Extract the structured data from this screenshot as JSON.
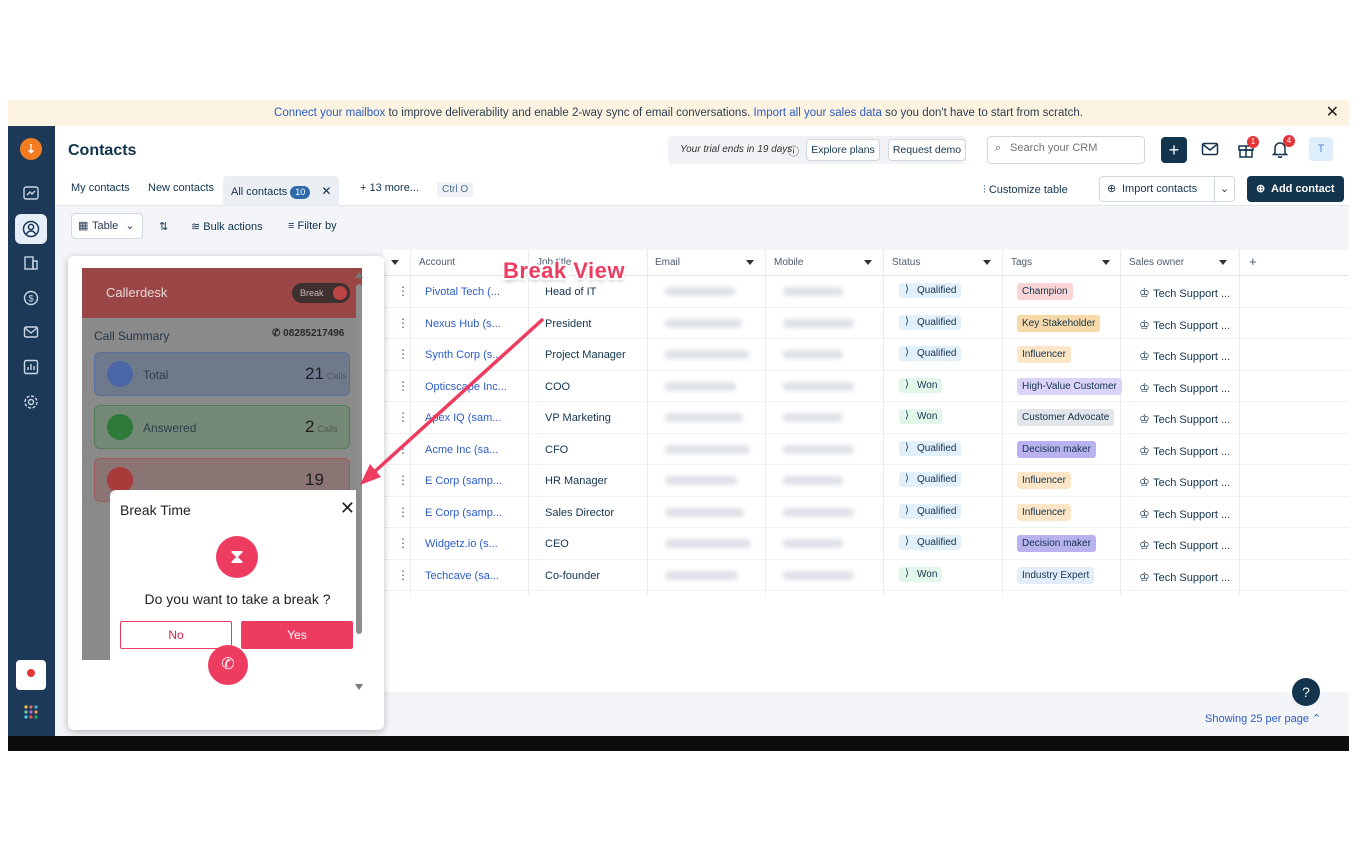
{
  "banner": {
    "link1": "Connect your mailbox",
    "text1": " to improve deliverability and enable 2-way sync of email conversations. ",
    "link2": "Import all your sales data",
    "text2": " so you don't have to start from scratch.",
    "close": "✕"
  },
  "header": {
    "title": "Contacts",
    "trial_text": "Your trial ends in 19 days",
    "explore_plans": "Explore plans",
    "request_demo": "Request demo",
    "search_placeholder": "Search your CRM",
    "plus": "+",
    "gift_badge": "1",
    "bell_badge": "4",
    "avatar": "T"
  },
  "tabs": {
    "my_contacts": "My contacts",
    "new_contacts": "New contacts",
    "all_contacts": "All contacts",
    "all_count": "10",
    "more": "+ 13 more...",
    "shortcut": "Ctrl O",
    "customize": "Customize table",
    "import": "Import contacts",
    "add_contact": "Add contact"
  },
  "toolbar": {
    "table": "Table",
    "bulk_actions": "Bulk actions",
    "filter_by": "Filter by"
  },
  "table": {
    "columns": [
      "Account",
      "Job title",
      "Email",
      "Mobile",
      "Status",
      "Tags",
      "Sales owner"
    ],
    "add_col": "+",
    "rows": [
      {
        "account": "Pivotal Tech (...",
        "job": "Head of IT",
        "status": "Qualified",
        "tag": "Champion",
        "owner": "Tech Support ..."
      },
      {
        "account": "Nexus Hub (s...",
        "job": "President",
        "status": "Qualified",
        "tag": "Key Stakeholder",
        "owner": "Tech Support ..."
      },
      {
        "account": "Synth Corp (s...",
        "job": "Project Manager",
        "status": "Qualified",
        "tag": "Influencer",
        "owner": "Tech Support ..."
      },
      {
        "account": "Opticscape Inc...",
        "job": "COO",
        "status": "Won",
        "tag": "High-Value Customer",
        "owner": "Tech Support ..."
      },
      {
        "account": "Apex IQ (sam...",
        "job": "VP Marketing",
        "status": "Won",
        "tag": "Customer Advocate",
        "owner": "Tech Support ..."
      },
      {
        "account": "Acme Inc (sa...",
        "job": "CFO",
        "status": "Qualified",
        "tag": "Decision maker",
        "owner": "Tech Support ..."
      },
      {
        "account": "E Corp (samp...",
        "job": "HR Manager",
        "status": "Qualified",
        "tag": "Influencer",
        "owner": "Tech Support ..."
      },
      {
        "account": "E Corp (samp...",
        "job": "Sales Director",
        "status": "Qualified",
        "tag": "Influencer",
        "owner": "Tech Support ..."
      },
      {
        "account": "Widgetz.io (s...",
        "job": "CEO",
        "status": "Qualified",
        "tag": "Decision maker",
        "owner": "Tech Support ..."
      },
      {
        "account": "Techcave (sa...",
        "job": "Co-founder",
        "status": "Won",
        "tag": "Industry Expert",
        "owner": "Tech Support ..."
      }
    ],
    "tag_colors": {
      "Champion": "#fbd5d6",
      "Key Stakeholder": "#f6d9a6",
      "Influencer": "#fde5c7",
      "High-Value Customer": "#dcd4f8",
      "Customer Advocate": "#e2e5e9",
      "Decision maker": "#b9b2ef",
      "Industry Expert": "#e4eefb"
    },
    "showing": "Showing 25 per page",
    "help": "?"
  },
  "panel": {
    "brand": "Callerdesk",
    "break_toggle": "Break",
    "call_summary": "Call Summary",
    "phone": "08285217496",
    "total_label": "Total",
    "total_num": "21",
    "answered_label": "Answered",
    "answered_num": "2",
    "unit": "Calls",
    "third_num": "19"
  },
  "modal": {
    "title": "Break Time",
    "close": "✕",
    "question": "Do you want to take a break ?",
    "no": "No",
    "yes": "Yes"
  },
  "annotation": {
    "label": "Break View",
    "color": "#ee3c61"
  },
  "colors": {
    "sidebar": "#1c3a58",
    "accent": "#12344d",
    "link": "#2c5cc5",
    "brand_pink": "#ee3c61"
  }
}
